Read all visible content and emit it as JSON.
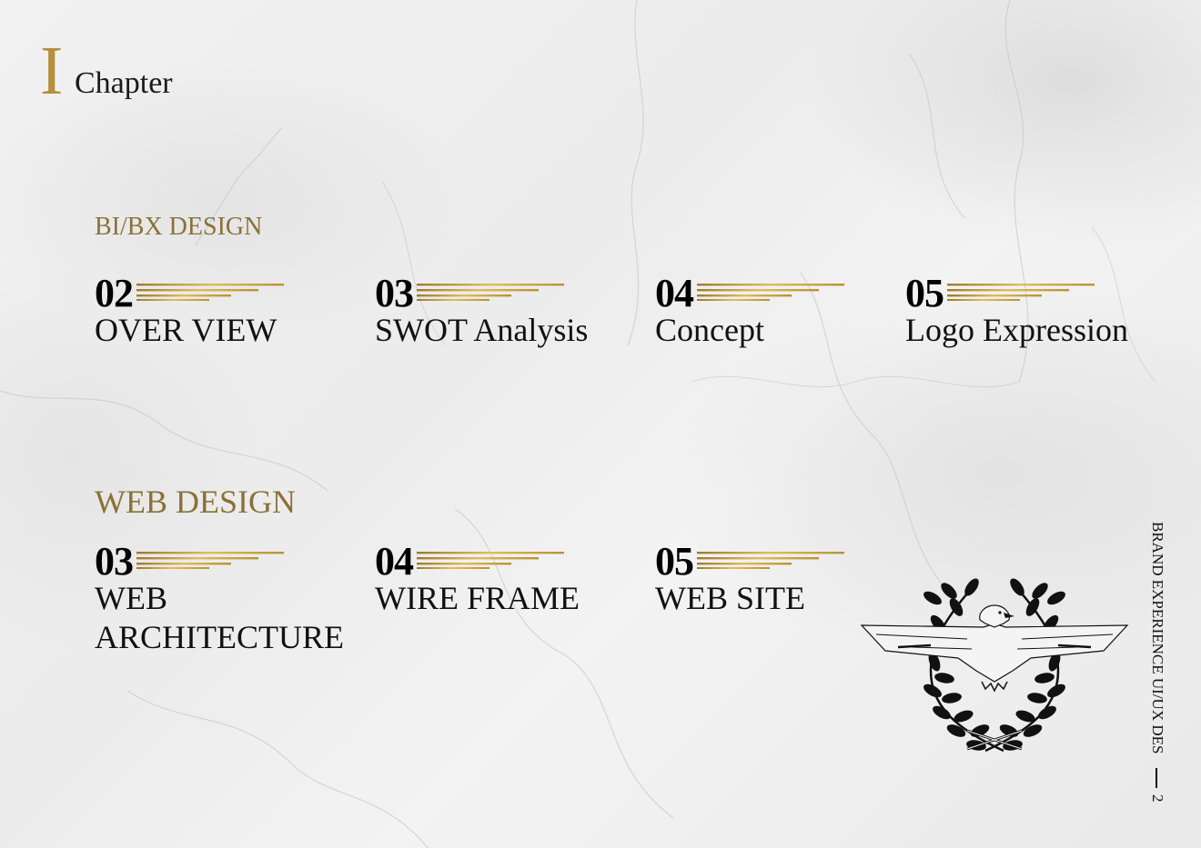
{
  "chapter": {
    "numeral": "I",
    "word": "Chapter"
  },
  "sections": {
    "bibx": {
      "title": "BI/BX DESIGN",
      "items": [
        {
          "number": "02",
          "label": "OVER VIEW"
        },
        {
          "number": "03",
          "label": "SWOT Analysis"
        },
        {
          "number": "04",
          "label": "Concept"
        },
        {
          "number": "05",
          "label": "Logo Expression"
        }
      ]
    },
    "web": {
      "title": "WEB DESIGN",
      "items": [
        {
          "number": "03",
          "label": "WEB ARCHITECTURE"
        },
        {
          "number": "04",
          "label": "WIRE FRAME"
        },
        {
          "number": "05",
          "label": "WEB SITE"
        }
      ]
    }
  },
  "sidebar": {
    "text": "BRAND EXPERIENCE UI/UX DES",
    "page": "2"
  },
  "colors": {
    "gold": "#b5913c",
    "gold_dark": "#8b7138",
    "text": "#111111"
  },
  "icons": {
    "emblem": "eagle-laurel-emblem-icon",
    "number_lines": "gold-lines-icon"
  }
}
